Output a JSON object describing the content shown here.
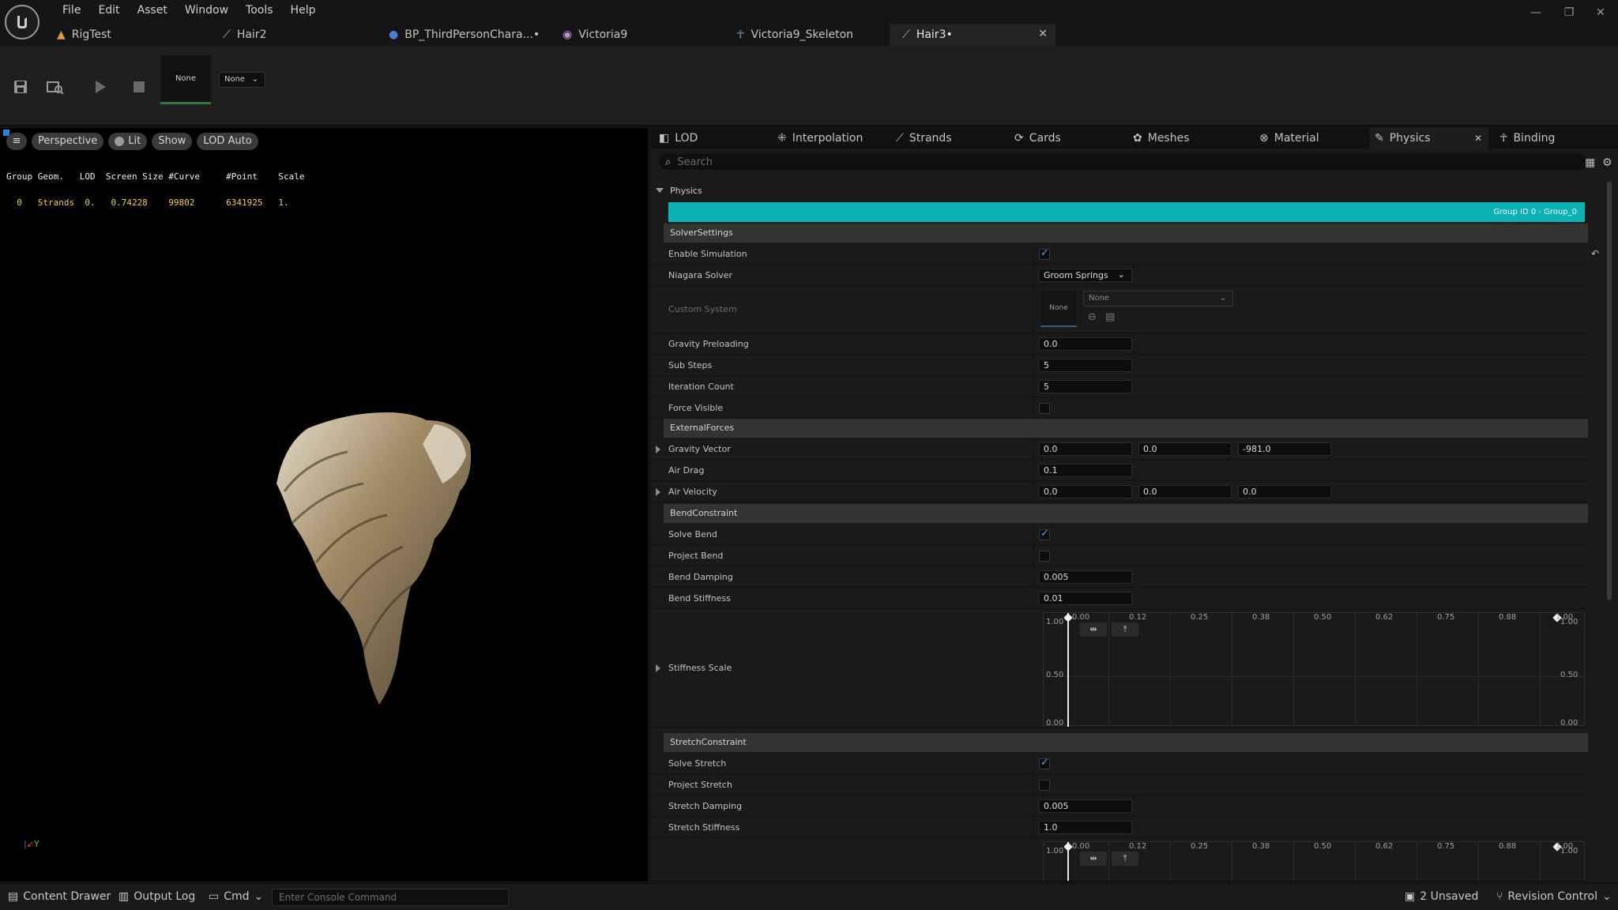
{
  "menu": [
    "File",
    "Edit",
    "Asset",
    "Window",
    "Tools",
    "Help"
  ],
  "doc_tabs": [
    {
      "label": "RigTest",
      "icon": "skeleton-icon"
    },
    {
      "label": "Hair2",
      "icon": "groom-icon"
    },
    {
      "label": "BP_ThirdPersonChara...•",
      "icon": "blueprint-icon"
    },
    {
      "label": "Victoria9",
      "icon": "mesh-icon"
    },
    {
      "label": "Victoria9_Skeleton",
      "icon": "skeleton-icon"
    },
    {
      "label": "Hair3•",
      "icon": "groom-icon"
    }
  ],
  "toolbar": {
    "none_thumb": "None",
    "none_dropdown": "None"
  },
  "viewport": {
    "buttons": [
      "Perspective",
      "Lit",
      "Show",
      "LOD Auto"
    ],
    "stats_header": "Group Geom.   LOD  Screen Size #Curve     #Point    Scale",
    "stats_row": "  0   Strands  0.   0.74228    99802      6341925   1."
  },
  "panel_tabs": [
    "LOD",
    "Interpolation",
    "Strands",
    "Cards",
    "Meshes",
    "Material",
    "Physics",
    "Binding"
  ],
  "search_placeholder": "Search",
  "physics": {
    "section": "Physics",
    "group_banner": "Group ID 0 - Group_0",
    "solver_settings": "SolverSettings",
    "enable_simulation": "Enable Simulation",
    "niagara_solver": "Niagara Solver",
    "niagara_solver_value": "Groom Springs",
    "custom_system": "Custom System",
    "custom_system_thumb": "None",
    "custom_system_value": "None",
    "gravity_preloading": "Gravity Preloading",
    "gravity_preloading_value": "0.0",
    "sub_steps": "Sub Steps",
    "sub_steps_value": "5",
    "iteration_count": "Iteration Count",
    "iteration_count_value": "5",
    "force_visible": "Force Visible",
    "external_forces": "ExternalForces",
    "gravity_vector": "Gravity Vector",
    "gravity_vector_values": [
      "0.0",
      "0.0",
      "-981.0"
    ],
    "air_drag": "Air Drag",
    "air_drag_value": "0.1",
    "air_velocity": "Air Velocity",
    "air_velocity_values": [
      "0.0",
      "0.0",
      "0.0"
    ],
    "bend_constraint": "BendConstraint",
    "solve_bend": "Solve Bend",
    "project_bend": "Project Bend",
    "bend_damping": "Bend Damping",
    "bend_damping_value": "0.005",
    "bend_stiffness": "Bend Stiffness",
    "bend_stiffness_value": "0.01",
    "stiffness_scale": "Stiffness Scale",
    "stretch_constraint": "StretchConstraint",
    "solve_stretch": "Solve Stretch",
    "project_stretch": "Project Stretch",
    "stretch_damping": "Stretch Damping",
    "stretch_damping_value": "0.005",
    "stretch_stiffness": "Stretch Stiffness",
    "stretch_stiffness_value": "1.0",
    "curve_x_ticks": [
      "0.00",
      "0.12",
      "0.25",
      "0.38",
      "0.50",
      "0.62",
      "0.75",
      "0.88",
      "1.00"
    ],
    "curve_y_ticks": [
      "1.00",
      "0.50",
      "0.00"
    ],
    "accent_color": "#0db2b6"
  },
  "status": {
    "content_drawer": "Content Drawer",
    "output_log": "Output Log",
    "cmd": "Cmd",
    "console_placeholder": "Enter Console Command",
    "unsaved": "2 Unsaved",
    "revision_control": "Revision Control"
  }
}
